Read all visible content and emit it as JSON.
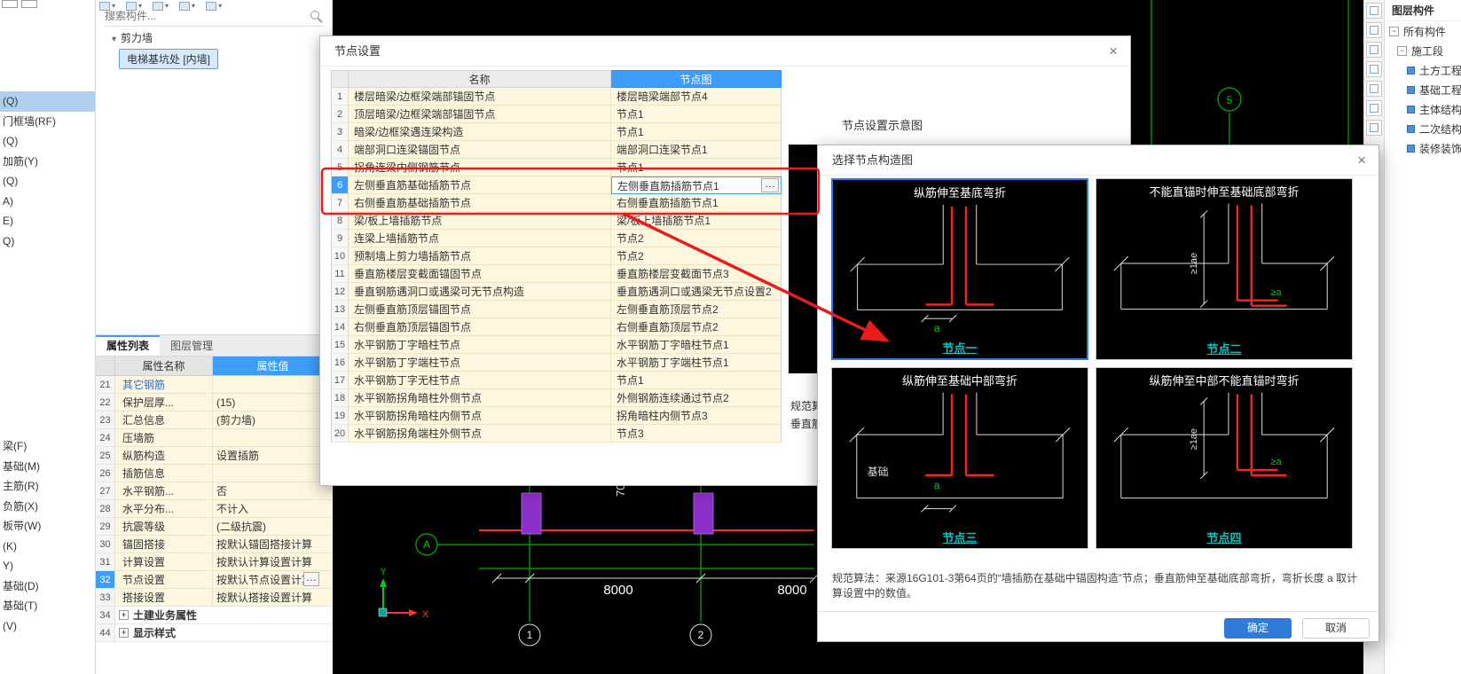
{
  "icons": {
    "close": "×",
    "caret_down": "▾",
    "plus": "+",
    "minus": "−",
    "ellipsis": "…"
  },
  "component_panel": {
    "search_placeholder": "搜索构件...",
    "tree_group": "剪力墙",
    "tree_item": "电梯基坑处 [内墙]"
  },
  "left_list": {
    "top": [
      "(Q)",
      "门框墙(RF)",
      "(Q)",
      "加筋(Y)",
      "(Q)",
      "A)",
      "E)",
      "Q)"
    ],
    "bottom": [
      "梁(F)",
      "基础(M)",
      "主筋(R)",
      "负筋(X)",
      "板带(W)",
      "(K)",
      "Y)",
      "基础(D)",
      "基础(T)",
      "(V)"
    ]
  },
  "properties": {
    "tabs": [
      "属性列表",
      "图层管理"
    ],
    "col_name": "属性名称",
    "col_value": "属性值",
    "rows": [
      {
        "num": "21",
        "name": "其它钢筋",
        "val": ""
      },
      {
        "num": "22",
        "name": "保护层厚...",
        "val": "(15)"
      },
      {
        "num": "23",
        "name": "汇总信息",
        "val": "(剪力墙)"
      },
      {
        "num": "24",
        "name": "压墙筋",
        "val": ""
      },
      {
        "num": "25",
        "name": "纵筋构造",
        "val": "设置插筋"
      },
      {
        "num": "26",
        "name": "插筋信息",
        "val": ""
      },
      {
        "num": "27",
        "name": "水平钢筋...",
        "val": "否"
      },
      {
        "num": "28",
        "name": "水平分布...",
        "val": "不计入"
      },
      {
        "num": "29",
        "name": "抗震等级",
        "val": "(二级抗震)"
      },
      {
        "num": "30",
        "name": "锚固搭接",
        "val": "按默认锚固搭接计算"
      },
      {
        "num": "31",
        "name": "计算设置",
        "val": "按默认计算设置计算"
      },
      {
        "num": "32",
        "name": "节点设置",
        "val": "按默认节点设置计算"
      },
      {
        "num": "33",
        "name": "搭接设置",
        "val": "按默认搭接设置计算"
      }
    ],
    "groups": [
      {
        "num": "34",
        "label": "土建业务属性"
      },
      {
        "num": "44",
        "label": "显示样式"
      }
    ]
  },
  "node_dialog": {
    "title": "节点设置",
    "col_name": "名称",
    "col_node": "节点图",
    "preview_label": "节点设置示意图",
    "clip_line1": "规范算",
    "clip_line2": "垂直筋",
    "rows": [
      {
        "num": "1",
        "name": "楼层暗梁/边框梁端部锚固节点",
        "val": "楼层暗梁端部节点4"
      },
      {
        "num": "2",
        "name": "顶层暗梁/边框梁端部锚固节点",
        "val": "节点1"
      },
      {
        "num": "3",
        "name": "暗梁/边框梁遇连梁构造",
        "val": "节点1"
      },
      {
        "num": "4",
        "name": "端部洞口连梁锚固节点",
        "val": "端部洞口连梁节点1"
      },
      {
        "num": "5",
        "name": "拐角连梁内侧钢筋节点",
        "val": "节点1"
      },
      {
        "num": "6",
        "name": "左侧垂直筋基础插筋节点",
        "val": "左侧垂直筋插筋节点1"
      },
      {
        "num": "7",
        "name": "右侧垂直筋基础插筋节点",
        "val": "右侧垂直筋插筋节点1"
      },
      {
        "num": "8",
        "name": "梁/板上墙插筋节点",
        "val": "梁/板上墙插筋节点1"
      },
      {
        "num": "9",
        "name": "连梁上墙插筋节点",
        "val": "节点2"
      },
      {
        "num": "10",
        "name": "预制墙上剪力墙插筋节点",
        "val": "节点2"
      },
      {
        "num": "11",
        "name": "垂直筋楼层变截面锚固节点",
        "val": "垂直筋楼层变截面节点3"
      },
      {
        "num": "12",
        "name": "垂直钢筋遇洞口或遇梁可无节点构造",
        "val": "垂直筋遇洞口或遇梁无节点设置2"
      },
      {
        "num": "13",
        "name": "左侧垂直筋顶层锚固节点",
        "val": "左侧垂直筋顶层节点2"
      },
      {
        "num": "14",
        "name": "右侧垂直筋顶层锚固节点",
        "val": "右侧垂直筋顶层节点2"
      },
      {
        "num": "15",
        "name": "水平钢筋丁字暗柱节点",
        "val": "水平钢筋丁字暗柱节点1"
      },
      {
        "num": "16",
        "name": "水平钢筋丁字端柱节点",
        "val": "水平钢筋丁字端柱节点1"
      },
      {
        "num": "17",
        "name": "水平钢筋丁字无柱节点",
        "val": "节点1"
      },
      {
        "num": "18",
        "name": "水平钢筋拐角暗柱外侧节点",
        "val": "外侧钢筋连续通过节点2"
      },
      {
        "num": "19",
        "name": "水平钢筋拐角暗柱内侧节点",
        "val": "拐角暗柱内侧节点3"
      },
      {
        "num": "20",
        "name": "水平钢筋拐角端柱外侧节点",
        "val": "节点3"
      }
    ]
  },
  "construct_dialog": {
    "title": "选择节点构造图",
    "panels": [
      {
        "title": "纵筋伸至基底弯折",
        "label": "节点一",
        "a_label": "a"
      },
      {
        "title": "不能直锚时伸至基础底部弯折",
        "label": "节点二",
        "a_label": "≥a",
        "lae_label": "≥1ae"
      },
      {
        "title": "纵筋伸至基础中部弯折",
        "label": "节点三",
        "a_label": "a",
        "extra_label": "基础"
      },
      {
        "title": "纵筋伸至中部不能直锚时弯折",
        "label": "节点四",
        "a_label": "≥a",
        "lae_label": "≥1ae"
      }
    ],
    "note": "规范算法：来源16G101-3第64页的“墙插筋在基础中锚固构造”节点；垂直筋伸至基础底部弯折，弯折长度 a 取计算设置中的数值。",
    "ok_label": "确定",
    "cancel_label": "取消"
  },
  "cad": {
    "dim_left": "8000",
    "dim_right": "8000",
    "dim_vertical": "70",
    "bubble_a": "A",
    "bubble_5": "5",
    "bubble_1": "1",
    "bubble_2": "2",
    "axis_x": "X",
    "axis_y": "Y"
  },
  "right_panel": {
    "title": "图层构件",
    "groups": [
      "所有构件",
      "施工段"
    ],
    "leaves": [
      "土方工程",
      "基础工程",
      "主体结构",
      "二次结构",
      "装修装饰"
    ]
  },
  "colors": {
    "accent": "#3f9dfa",
    "annotation": "#e81c1c",
    "cad_green": "#00b400",
    "cad_purple": "#8b2fc9",
    "node_label": "#00c7c7"
  }
}
